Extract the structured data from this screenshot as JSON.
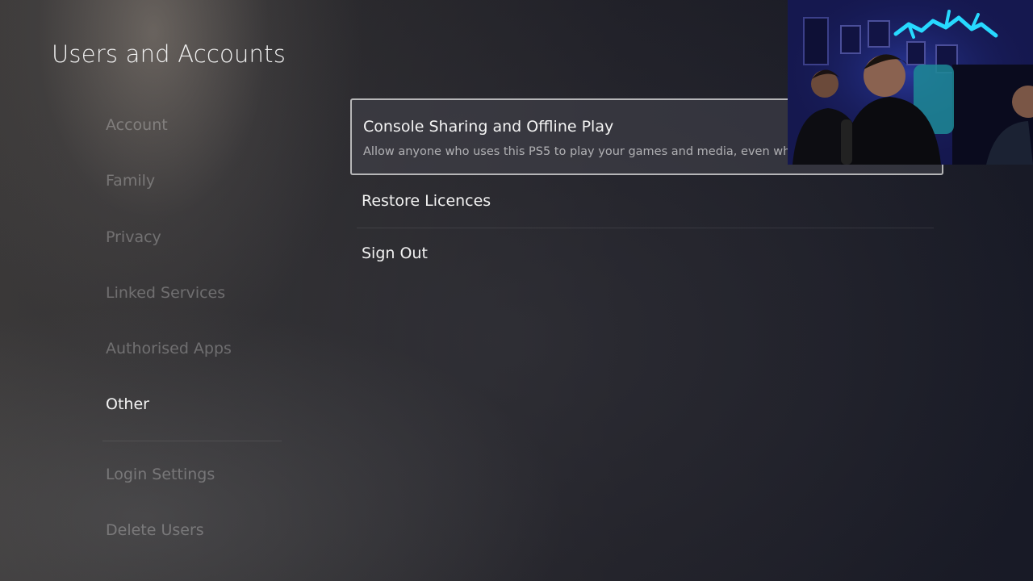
{
  "page": {
    "title": "Users and Accounts"
  },
  "sidebar": {
    "items": [
      {
        "label": "Account",
        "active": false
      },
      {
        "label": "Family",
        "active": false
      },
      {
        "label": "Privacy",
        "active": false
      },
      {
        "label": "Linked Services",
        "active": false
      },
      {
        "label": "Authorised Apps",
        "active": false
      },
      {
        "label": "Other",
        "active": true
      },
      {
        "label": "Login Settings",
        "active": false
      },
      {
        "label": "Delete Users",
        "active": false
      }
    ]
  },
  "options": {
    "console_sharing": {
      "title": "Console Sharing and Offline Play",
      "description": "Allow anyone who uses this PS5 to play your games and media, even whe"
    },
    "restore_licences": {
      "title": "Restore Licences"
    },
    "sign_out": {
      "title": "Sign Out"
    }
  },
  "overlay": {
    "type": "webcam-feed",
    "accent_color": "#27d9ff"
  }
}
